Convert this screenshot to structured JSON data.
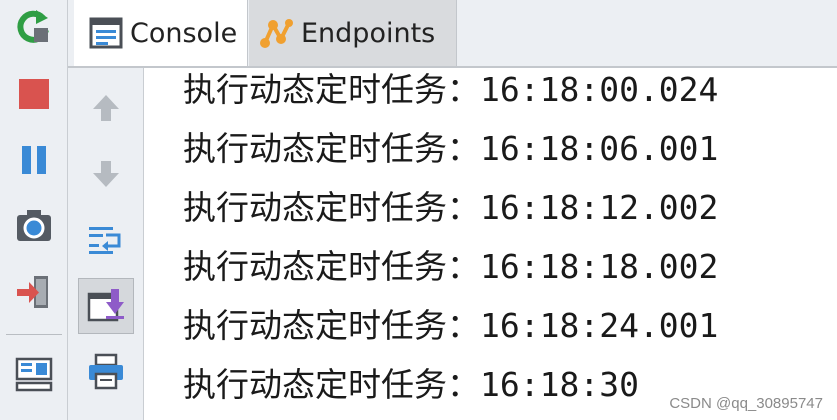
{
  "tabs": [
    {
      "label": "Console",
      "icon": "console-icon",
      "selected": true
    },
    {
      "label": "Endpoints",
      "icon": "endpoints-icon",
      "selected": false
    }
  ],
  "left_toolbar": [
    {
      "icon": "rerun-icon",
      "color": "#2f9e44"
    },
    {
      "icon": "stop-icon",
      "color": "#d9534f"
    },
    {
      "icon": "pause-icon",
      "color": "#3a8ad6"
    },
    {
      "icon": "camera-icon",
      "color": "#555b63"
    },
    {
      "icon": "exit-icon",
      "color": "#d9534f"
    },
    {
      "icon": "layout-icon",
      "color": "#3a8ad6"
    }
  ],
  "console_toolbar": [
    {
      "icon": "arrow-up-icon",
      "enabled": false
    },
    {
      "icon": "arrow-down-icon",
      "enabled": false
    },
    {
      "icon": "soft-wrap-icon",
      "enabled": true
    },
    {
      "icon": "scroll-to-end-icon",
      "enabled": true,
      "active": true
    },
    {
      "icon": "print-icon",
      "enabled": true
    }
  ],
  "console": {
    "lines": [
      {
        "text": "执行动态定时任务：",
        "time": "16:18:00.024"
      },
      {
        "text": "执行动态定时任务：",
        "time": "16:18:06.001"
      },
      {
        "text": "执行动态定时任务：",
        "time": "16:18:12.002"
      },
      {
        "text": "执行动态定时任务：",
        "time": "16:18:18.002"
      },
      {
        "text": "执行动态定时任务：",
        "time": "16:18:24.001"
      },
      {
        "text": "执行动态定时任务：",
        "time": "16:18:30"
      }
    ]
  },
  "watermark": "CSDN @qq_30895747"
}
